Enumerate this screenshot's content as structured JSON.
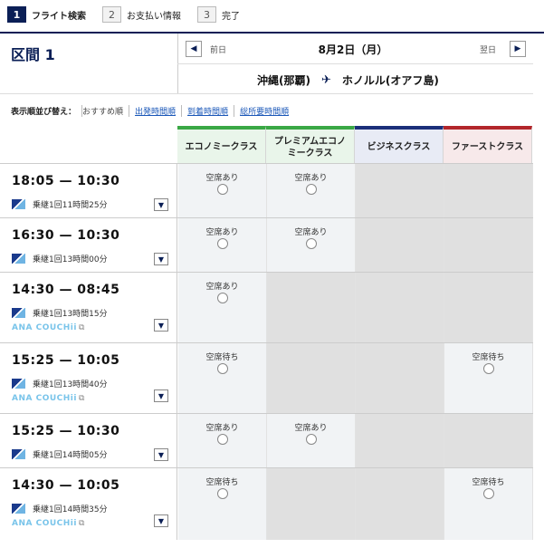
{
  "steps": [
    {
      "num": "1",
      "label": "フライト検索",
      "active": true
    },
    {
      "num": "2",
      "label": "お支払い情報",
      "active": false
    },
    {
      "num": "3",
      "label": "完了",
      "active": false
    }
  ],
  "section_title": "区間 1",
  "date_nav": {
    "prev_label": "前日",
    "date": "8月2日（月）",
    "next_label": "翌日"
  },
  "route": {
    "origin": "沖縄(那覇)",
    "destination": "ホノルル(オアフ島)"
  },
  "sort": {
    "caption": "表示順並び替え：",
    "current": "おすすめ順",
    "options": [
      "出発時間順",
      "到着時間順",
      "総所要時間順"
    ]
  },
  "cabin_classes": [
    {
      "label": "エコノミークラス",
      "color": "#3aa845",
      "bg": "#e9f5ea"
    },
    {
      "label": "プレミアムエコノミークラス",
      "color": "#3aa845",
      "bg": "#e9f5ea"
    },
    {
      "label": "ビジネスクラス",
      "color": "#1b2f7a",
      "bg": "#e8ebf5"
    },
    {
      "label": "ファーストクラス",
      "color": "#b3262b",
      "bg": "#f7e9ea"
    }
  ],
  "flights": [
    {
      "times": "18:05 — 10:30",
      "route_info": "乗継1回11時間25分",
      "couchii": null,
      "seats": [
        "空席あり",
        "空席あり",
        null,
        null
      ]
    },
    {
      "times": "16:30 — 10:30",
      "route_info": "乗継1回13時間00分",
      "couchii": null,
      "seats": [
        "空席あり",
        "空席あり",
        null,
        null
      ]
    },
    {
      "times": "14:30 — 08:45",
      "route_info": "乗継1回13時間15分",
      "couchii": "ANA COUCHii",
      "seats": [
        "空席あり",
        null,
        null,
        null
      ]
    },
    {
      "times": "15:25 — 10:05",
      "route_info": "乗継1回13時間40分",
      "couchii": "ANA COUCHii",
      "seats": [
        "空席待ち",
        null,
        null,
        "空席待ち"
      ]
    },
    {
      "times": "15:25 — 10:30",
      "route_info": "乗継1回14時間05分",
      "couchii": null,
      "seats": [
        "空席あり",
        "空席あり",
        null,
        null
      ]
    },
    {
      "times": "14:30 — 10:05",
      "route_info": "乗継1回14時間35分",
      "couchii": "ANA COUCHii",
      "seats": [
        "空席待ち",
        null,
        null,
        "空席待ち"
      ]
    }
  ]
}
